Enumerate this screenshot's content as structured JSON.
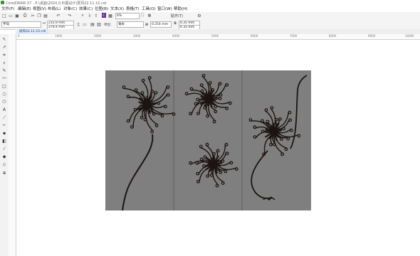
{
  "app": {
    "title": "CorelDRAW X7 - E:\\桌面\\2020.0.8\\图设计\\屏风22.11.15.cdr"
  },
  "menubar": {
    "items": [
      "文件(F)",
      "编辑(E)",
      "视图(V)",
      "布局(L)",
      "对象(C)",
      "效果(C)",
      "位图(B)",
      "文本(X)",
      "表格(T)",
      "工具(O)",
      "窗口(W)",
      "帮助(H)"
    ]
  },
  "toolbar": {
    "zoom": "6%",
    "snap_label": "贴齐(T)"
  },
  "propbar": {
    "preset": "字母",
    "width": "215.9 mm",
    "height": "279.4 mm",
    "units_label": "单位:",
    "units_value": "毫米",
    "nudge": "0.254 mm",
    "dup_x": "6.35 mm",
    "dup_y": "6.35 mm"
  },
  "document": {
    "tab_label": "屏风22.11.15.cdr"
  },
  "ruler": {
    "h_ticks": [
      "0",
      "1000",
      "2000",
      "3000",
      "4000",
      "5000",
      "6000",
      "7000",
      "8000",
      "9000",
      "10000"
    ]
  },
  "colors": {
    "artboard": "#7f7f7f",
    "flower": "#1c1411",
    "divider": "#5c5c5c",
    "ui_bg": "#f4f4f4"
  },
  "icons": [
    "app-icon",
    "new-icon",
    "open-icon",
    "save-icon",
    "print-icon",
    "cut-icon",
    "copy-icon",
    "paste-icon",
    "undo-icon",
    "redo-icon",
    "search-icon",
    "import-icon",
    "export-icon",
    "corel-connect-icon",
    "launcher-icon",
    "fullscreen-icon",
    "options-icon"
  ],
  "canvas": {
    "artwork": "three-panel screen with chrysanthemum line art"
  }
}
